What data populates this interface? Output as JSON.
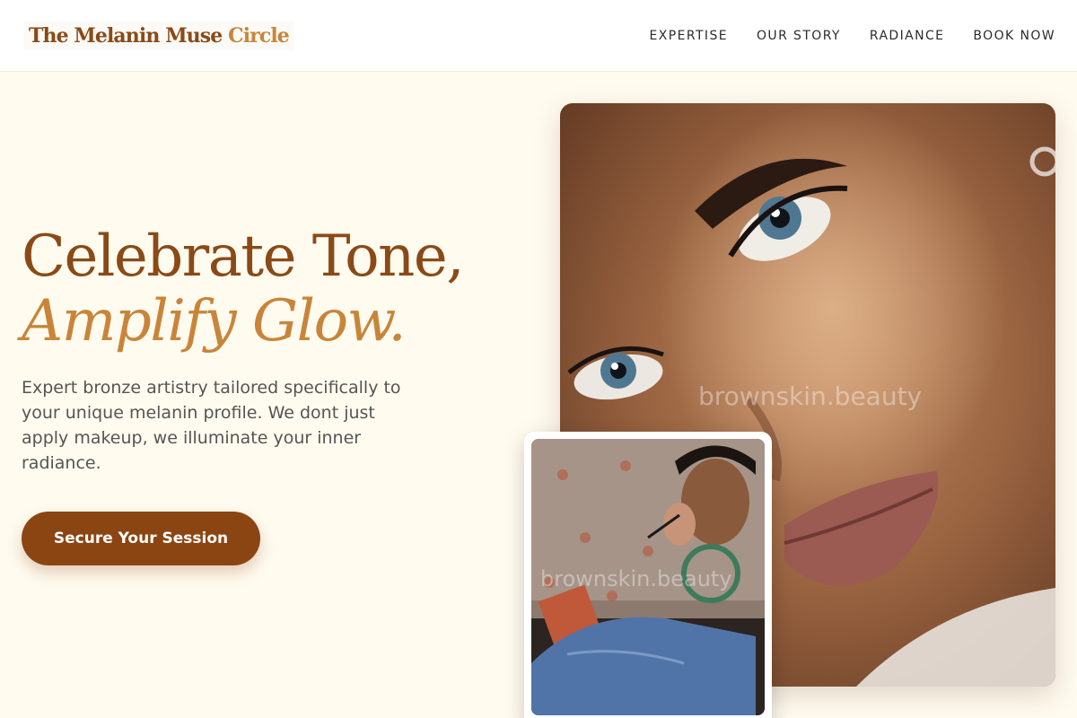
{
  "header": {
    "logo_part1": "The Melanin Muse",
    "logo_part2": "Circle",
    "nav": [
      "EXPERTISE",
      "OUR STORY",
      "RADIANCE",
      "BOOK NOW"
    ]
  },
  "hero": {
    "title_line1": "Celebrate Tone,",
    "title_line2": "Amplify Glow.",
    "description": "Expert bronze artistry tailored specifically to your unique melanin profile. We dont just apply makeup, we illuminate your inner radiance.",
    "cta_label": "Secure Your Session"
  },
  "images": {
    "main_watermark": "brownskin.beauty",
    "card_watermark": "brownskin.beauty"
  },
  "colors": {
    "background": "#fffbef",
    "brand_brown": "#8b4513",
    "accent_gold": "#c8853a"
  }
}
